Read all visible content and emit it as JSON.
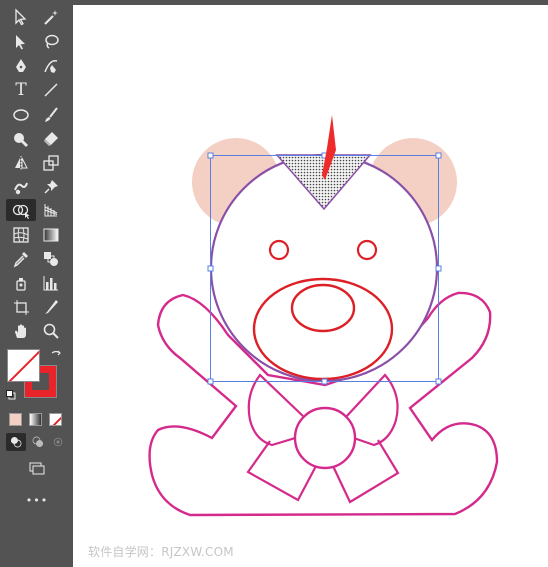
{
  "toolbar": {
    "tools": [
      {
        "name": "selection-tool",
        "icon": "arrow-outline-icon"
      },
      {
        "name": "magic-wand-tool",
        "icon": "magic-wand-icon"
      },
      {
        "name": "direct-selection-tool",
        "icon": "arrow-solid-icon"
      },
      {
        "name": "lasso-tool",
        "icon": "lasso-icon"
      },
      {
        "name": "pen-tool",
        "icon": "pen-icon"
      },
      {
        "name": "curvature-tool",
        "icon": "curvature-icon"
      },
      {
        "name": "type-tool",
        "icon": "type-icon",
        "glyph": "T"
      },
      {
        "name": "line-tool",
        "icon": "line-icon"
      },
      {
        "name": "ellipse-tool",
        "icon": "ellipse-icon"
      },
      {
        "name": "paintbrush-tool",
        "icon": "brush-icon"
      },
      {
        "name": "shaper-tool",
        "icon": "shaper-icon"
      },
      {
        "name": "eraser-tool",
        "icon": "eraser-icon"
      },
      {
        "name": "reflect-tool",
        "icon": "reflect-icon"
      },
      {
        "name": "scale-tool",
        "icon": "scale-icon"
      },
      {
        "name": "warp-tool",
        "icon": "warp-icon"
      },
      {
        "name": "puppet-warp-tool",
        "icon": "pin-icon"
      },
      {
        "name": "shape-builder-tool",
        "icon": "shape-builder-icon",
        "active": true
      },
      {
        "name": "perspective-grid-tool",
        "icon": "perspective-icon"
      },
      {
        "name": "mesh-tool",
        "icon": "mesh-icon"
      },
      {
        "name": "gradient-tool",
        "icon": "gradient-icon"
      },
      {
        "name": "eyedropper-tool",
        "icon": "eyedropper-icon"
      },
      {
        "name": "blend-tool",
        "icon": "blend-icon"
      },
      {
        "name": "symbol-sprayer-tool",
        "icon": "spray-icon"
      },
      {
        "name": "column-graph-tool",
        "icon": "graph-icon"
      },
      {
        "name": "artboard-tool",
        "icon": "artboard-icon"
      },
      {
        "name": "slice-tool",
        "icon": "slice-icon"
      },
      {
        "name": "hand-tool",
        "icon": "hand-icon"
      },
      {
        "name": "zoom-tool",
        "icon": "zoom-icon"
      }
    ],
    "more_label": "•••"
  },
  "colors": {
    "fill": "none",
    "stroke": "#e8232a",
    "ear_fill": "#f4cfc3",
    "head_stroke": "#8a4fa8",
    "body_stroke": "#d42a8c",
    "face_stroke": "#dd1f26",
    "selection": "#5a7fe0",
    "arrow_red": "#ee2a2a"
  },
  "watermark": "软件自学网：RJZXW.COM"
}
